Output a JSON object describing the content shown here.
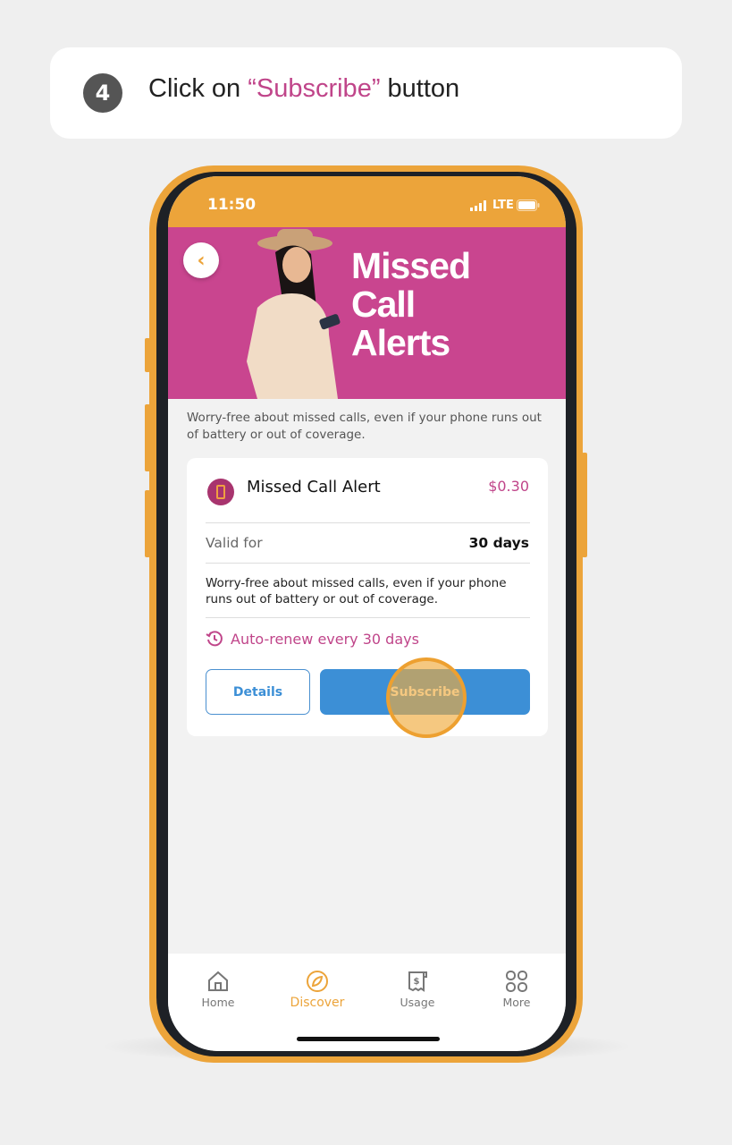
{
  "instruction": {
    "step": "4",
    "prefix": "Click on ",
    "highlight": "“Subscribe”",
    "suffix": " button"
  },
  "status_bar": {
    "time": "11:50",
    "network": "LTE"
  },
  "banner": {
    "title": "Missed\nCall\nAlerts",
    "back_icon": "chevron-left-icon"
  },
  "description": "Worry-free about missed calls, even if your phone runs out of battery or out of coverage.",
  "card": {
    "title": "Missed Call Alert",
    "price": "$0.30",
    "valid_label": "Valid for",
    "valid_value": "30 days",
    "description": "Worry-free about missed calls, even if your phone runs out of battery or out of coverage.",
    "auto_renew": "Auto-renew every 30 days",
    "details_label": "Details",
    "subscribe_label": "Subscribe"
  },
  "tabs": [
    {
      "label": "Home",
      "icon": "home-icon"
    },
    {
      "label": "Discover",
      "icon": "compass-icon",
      "active": true
    },
    {
      "label": "Usage",
      "icon": "receipt-dollar-icon"
    },
    {
      "label": "More",
      "icon": "grid-icon"
    }
  ],
  "colors": {
    "accent_orange": "#eca43a",
    "brand_pink": "#c9458f",
    "button_blue": "#3c8fd6"
  }
}
